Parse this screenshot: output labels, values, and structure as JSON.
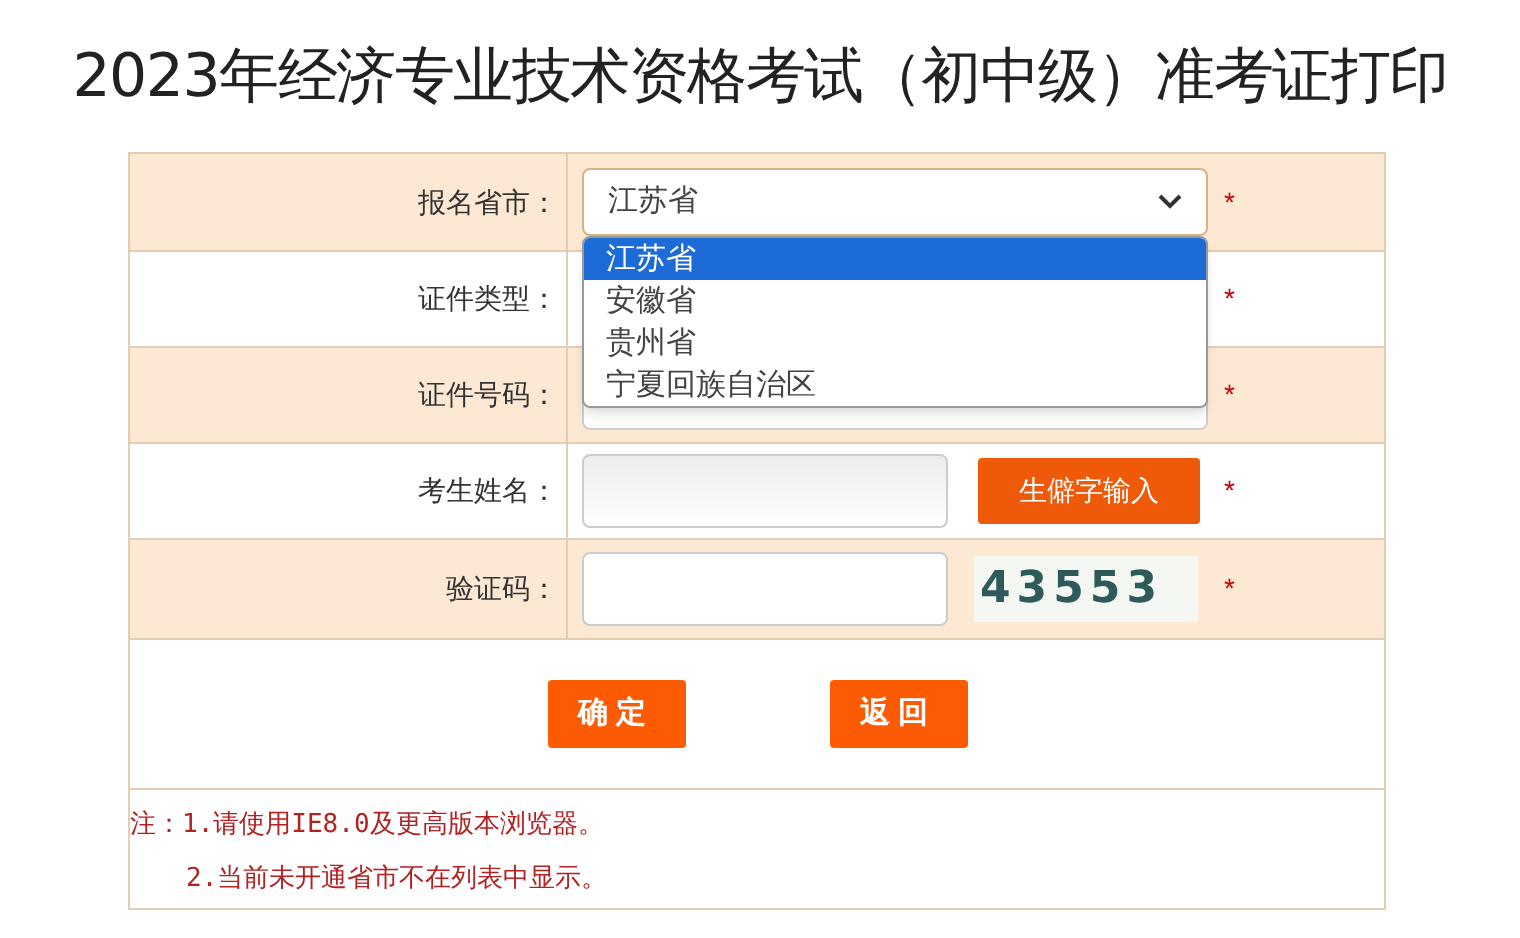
{
  "title": "2023年经济专业技术资格考试（初中级）准考证打印",
  "rows": [
    {
      "label": "报名省市：",
      "kind": "select",
      "value": "江苏省",
      "mark": "*"
    },
    {
      "label": "证件类型：",
      "kind": "covered",
      "mark": "*"
    },
    {
      "label": "证件号码：",
      "kind": "text",
      "mark": "*"
    },
    {
      "label": "考生姓名：",
      "kind": "name",
      "button": "生僻字输入",
      "mark": "*"
    },
    {
      "label": "验证码：",
      "kind": "captcha",
      "captcha": "43553",
      "mark": "*"
    }
  ],
  "dropdown": {
    "options": [
      {
        "label": "江苏省",
        "selected": true
      },
      {
        "label": "安徽省",
        "selected": false
      },
      {
        "label": "贵州省",
        "selected": false
      },
      {
        "label": "宁夏回族自治区",
        "selected": false
      }
    ]
  },
  "buttons": [
    "确定",
    "返回"
  ],
  "notes": [
    "注：1.请使用IE8.0及更高版本浏览器。",
    "2.当前未开通省市不在列表中显示。"
  ]
}
